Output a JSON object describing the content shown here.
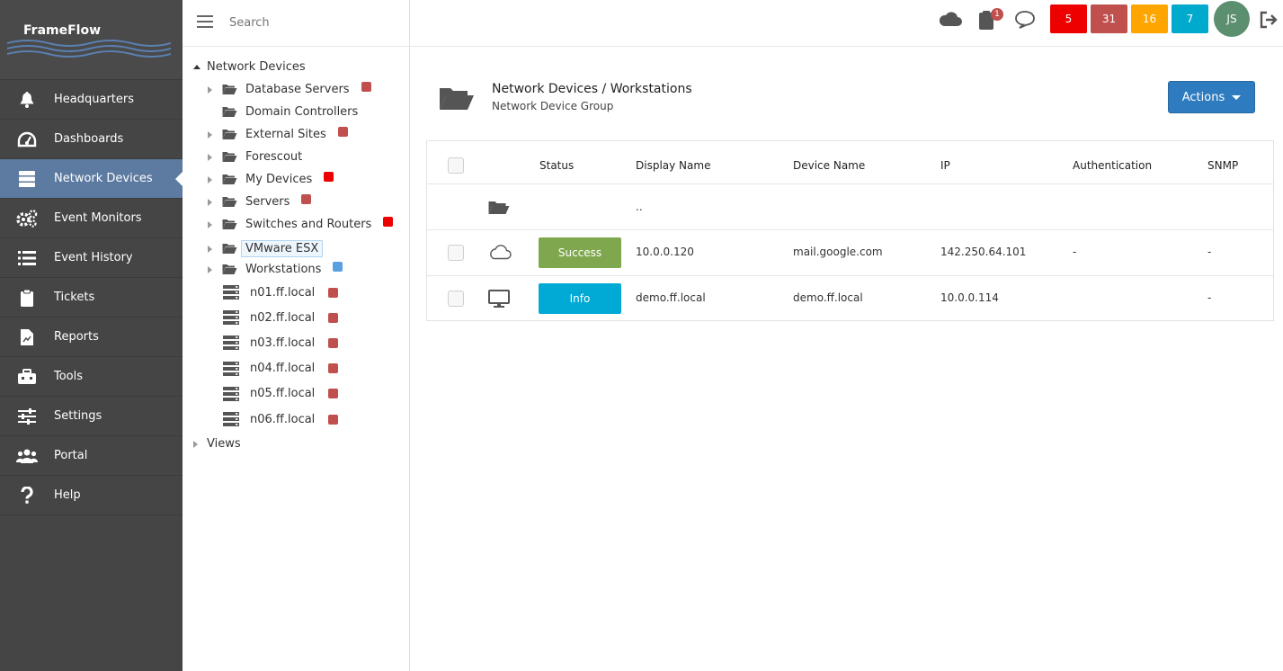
{
  "app": {
    "brand": "FrameFlow"
  },
  "nav": {
    "items": [
      {
        "label": "Headquarters",
        "icon": "bell-icon"
      },
      {
        "label": "Dashboards",
        "icon": "dashboard-gauge-icon"
      },
      {
        "label": "Network Devices",
        "icon": "server-stack-icon",
        "active": true
      },
      {
        "label": "Event Monitors",
        "icon": "gears-icon"
      },
      {
        "label": "Event History",
        "icon": "list-icon"
      },
      {
        "label": "Tickets",
        "icon": "clipboard-icon"
      },
      {
        "label": "Reports",
        "icon": "report-file-icon"
      },
      {
        "label": "Tools",
        "icon": "toolbox-icon"
      },
      {
        "label": "Settings",
        "icon": "sliders-icon"
      },
      {
        "label": "Portal",
        "icon": "users-icon"
      },
      {
        "label": "Help",
        "icon": "question-icon"
      }
    ]
  },
  "tree": {
    "search_placeholder": "Search",
    "root": "Network Devices",
    "groups": [
      {
        "label": "Database Servers",
        "status": "#c0504d",
        "expandable": true
      },
      {
        "label": "Domain Controllers",
        "status": null,
        "expandable": false
      },
      {
        "label": "External Sites",
        "status": "#c0504d",
        "expandable": true
      },
      {
        "label": "Forescout",
        "status": null,
        "expandable": true
      },
      {
        "label": "My Devices",
        "status": "#ee0000",
        "expandable": true
      },
      {
        "label": "Servers",
        "status": "#c0504d",
        "expandable": true
      },
      {
        "label": "Switches and Routers",
        "status": "#ee0000",
        "expandable": true
      },
      {
        "label": "VMware ESX",
        "status": null,
        "expandable": true,
        "hover": true
      },
      {
        "label": "Workstations",
        "status": "#5aa0e0",
        "expandable": true
      }
    ],
    "devices": [
      {
        "label": "n01.ff.local",
        "status": "#c0504d"
      },
      {
        "label": "n02.ff.local",
        "status": "#c0504d"
      },
      {
        "label": "n03.ff.local",
        "status": "#c0504d"
      },
      {
        "label": "n04.ff.local",
        "status": "#c0504d"
      },
      {
        "label": "n05.ff.local",
        "status": "#c0504d"
      },
      {
        "label": "n06.ff.local",
        "status": "#c0504d"
      }
    ],
    "views": "Views"
  },
  "topbar": {
    "notification_count": "1",
    "counters": [
      {
        "value": "5",
        "color": "#ee0000"
      },
      {
        "value": "31",
        "color": "#c0504d"
      },
      {
        "value": "16",
        "color": "#ffa500"
      },
      {
        "value": "7",
        "color": "#00aacc"
      }
    ],
    "avatar": "JS"
  },
  "main": {
    "breadcrumb": "Network Devices / Workstations",
    "subtitle": "Network Device Group",
    "actions_label": "Actions",
    "columns": [
      "Status",
      "Display Name",
      "Device Name",
      "IP",
      "Authentication",
      "SNMP"
    ],
    "parent_row": "..",
    "rows": [
      {
        "icon": "cloud-icon",
        "status": "Success",
        "status_color": "#7fa84e",
        "display_name": "10.0.0.120",
        "device_name": "mail.google.com",
        "ip": "142.250.64.101",
        "authentication": "-",
        "snmp": "-"
      },
      {
        "icon": "monitor-icon",
        "status": "Info",
        "status_color": "#00aad4",
        "display_name": "demo.ff.local",
        "device_name": "demo.ff.local",
        "ip": "10.0.0.114",
        "authentication": "",
        "snmp": "-"
      }
    ]
  }
}
